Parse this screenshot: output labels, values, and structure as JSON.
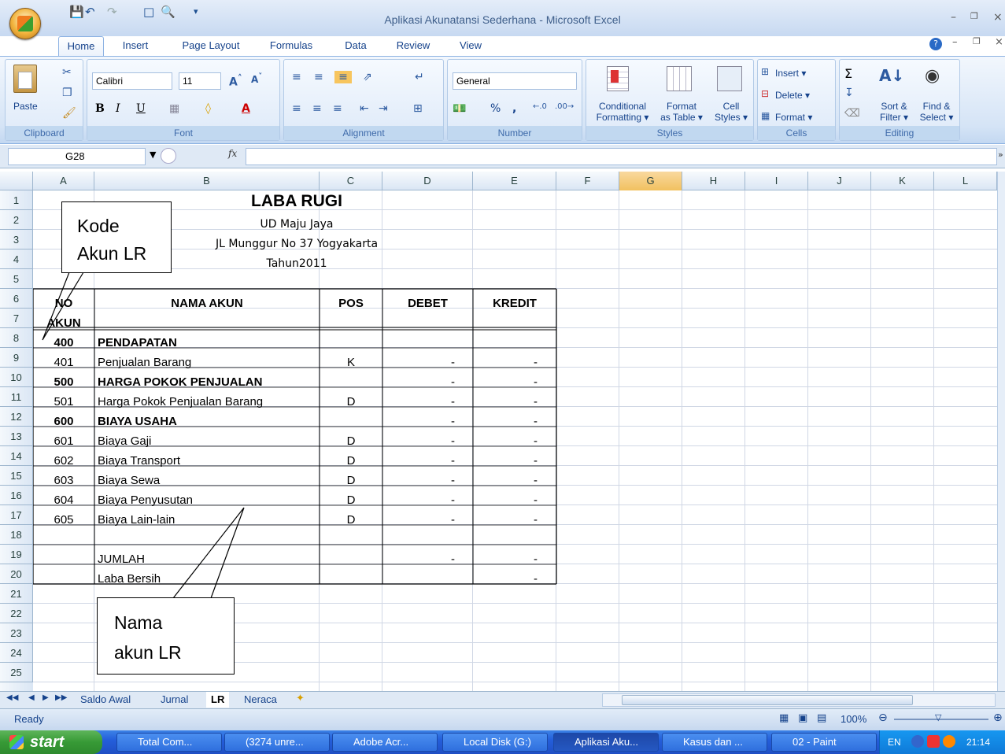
{
  "window": {
    "title": "Aplikasi Akunatansi Sederhana - Microsoft Excel"
  },
  "ribbon": {
    "tabs": [
      "Home",
      "Insert",
      "Page Layout",
      "Formulas",
      "Data",
      "Review",
      "View"
    ],
    "clipboard": {
      "label": "Clipboard",
      "paste": "Paste"
    },
    "font": {
      "label": "Font",
      "name": "Calibri",
      "size": "11",
      "bold": "B",
      "italic": "I",
      "underline": "U"
    },
    "alignment": {
      "label": "Alignment"
    },
    "number": {
      "label": "Number",
      "format": "General",
      "percent": "%",
      "comma": ","
    },
    "styles": {
      "label": "Styles",
      "conditional": [
        "Conditional",
        "Formatting ▾"
      ],
      "table": [
        "Format",
        "as Table ▾"
      ],
      "cell": [
        "Cell",
        "Styles ▾"
      ]
    },
    "cells": {
      "label": "Cells",
      "insert": "Insert ▾",
      "delete": "Delete ▾",
      "format": "Format ▾"
    },
    "editing": {
      "label": "Editing",
      "sort": [
        "Sort &",
        "Filter ▾"
      ],
      "find": [
        "Find &",
        "Select ▾"
      ]
    }
  },
  "formula_bar": {
    "name_box": "G28",
    "fx": "fx",
    "value": ""
  },
  "columns": [
    "A",
    "B",
    "C",
    "D",
    "E",
    "F",
    "G",
    "H",
    "I",
    "J",
    "K",
    "L"
  ],
  "selected_column": "G",
  "rows": [
    "1",
    "2",
    "3",
    "4",
    "5",
    "6",
    "7",
    "8",
    "9",
    "10",
    "11",
    "12",
    "13",
    "14",
    "15",
    "16",
    "17",
    "18",
    "19",
    "20",
    "21",
    "22",
    "23",
    "24",
    "25"
  ],
  "sheet": {
    "title": "LABA RUGI",
    "company": "UD Maju Jaya",
    "address": "JL Munggur No 37 Yogyakarta",
    "year": "Tahun2011",
    "headers": {
      "no": "NO",
      "akun": "AKUN",
      "nama": "NAMA AKUN",
      "pos": "POS",
      "debet": "DEBET",
      "kredit": "KREDIT"
    },
    "accounts": [
      {
        "code": "400",
        "name": "PENDAPATAN",
        "pos": "",
        "debet": "",
        "kredit": "",
        "bold": true
      },
      {
        "code": "401",
        "name": "Penjualan Barang",
        "pos": "K",
        "debet": "-",
        "kredit": "-",
        "bold": false
      },
      {
        "code": "500",
        "name": "HARGA POKOK PENJUALAN",
        "pos": "",
        "debet": "-",
        "kredit": "-",
        "bold": true
      },
      {
        "code": "501",
        "name": "Harga Pokok Penjualan Barang",
        "pos": "D",
        "debet": "-",
        "kredit": "-",
        "bold": false
      },
      {
        "code": "600",
        "name": "BIAYA USAHA",
        "pos": "",
        "debet": "-",
        "kredit": "-",
        "bold": true
      },
      {
        "code": "601",
        "name": "Biaya Gaji",
        "pos": "D",
        "debet": "-",
        "kredit": "-",
        "bold": false
      },
      {
        "code": "602",
        "name": "Biaya Transport",
        "pos": "D",
        "debet": "-",
        "kredit": "-",
        "bold": false
      },
      {
        "code": "603",
        "name": "Biaya Sewa",
        "pos": "D",
        "debet": "-",
        "kredit": "-",
        "bold": false
      },
      {
        "code": "604",
        "name": "Biaya Penyusutan",
        "pos": "D",
        "debet": "-",
        "kredit": "-",
        "bold": false
      },
      {
        "code": "605",
        "name": "Biaya Lain-lain",
        "pos": "D",
        "debet": "-",
        "kredit": "-",
        "bold": false
      }
    ],
    "jumlah": {
      "label": "JUMLAH",
      "debet": "-",
      "kredit": "-"
    },
    "laba": {
      "label": "Laba Bersih",
      "kredit": "-"
    }
  },
  "callouts": {
    "kode": [
      "Kode",
      "Akun LR"
    ],
    "nama": [
      "Nama",
      "akun LR"
    ]
  },
  "sheet_tabs": [
    "Saldo Awal",
    "Jurnal",
    "LR",
    "Neraca"
  ],
  "active_sheet": "LR",
  "status": {
    "ready": "Ready",
    "zoom": "100%"
  },
  "taskbar": {
    "start": "start",
    "buttons": [
      "Total Com...",
      "(3274 unre...",
      "Adobe Acr...",
      "Local Disk (G:)",
      "Aplikasi Aku...",
      "Kasus dan ...",
      "02 - Paint"
    ],
    "active": "Aplikasi Aku...",
    "lang": "EN",
    "clock": "21:14"
  }
}
